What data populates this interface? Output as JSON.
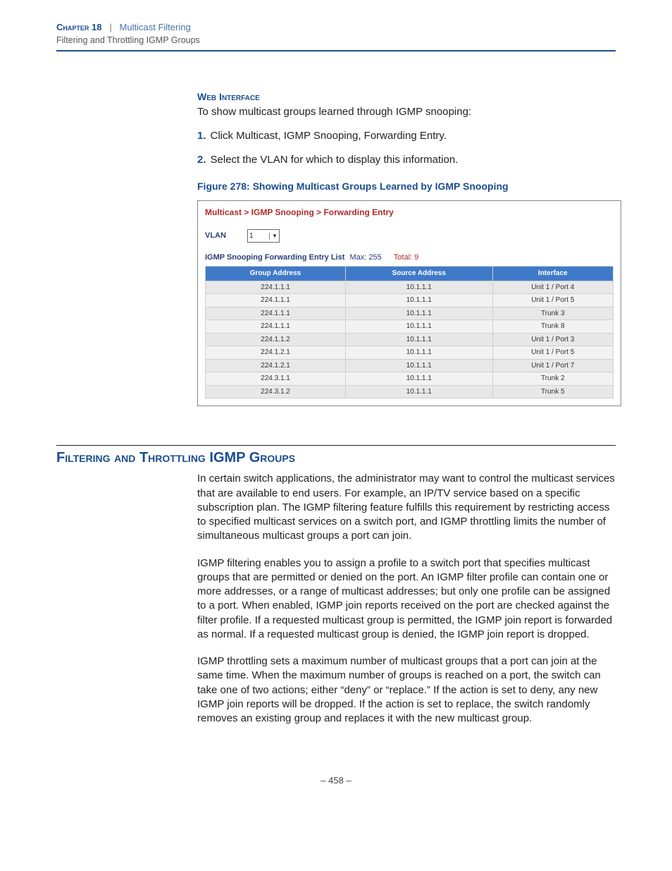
{
  "header": {
    "chapter_label": "Chapter 18",
    "separator": "|",
    "chapter_title": "Multicast Filtering",
    "subtitle": "Filtering and Throttling IGMP Groups"
  },
  "intro": {
    "heading": "Web Interface",
    "lead": "To show multicast groups learned through IGMP snooping:",
    "steps": [
      "Click Multicast, IGMP Snooping, Forwarding Entry.",
      "Select the VLAN for which to display this information."
    ],
    "figure_caption": "Figure 278:  Showing Multicast Groups Learned by IGMP Snooping"
  },
  "panel": {
    "breadcrumb": "Multicast > IGMP Snooping > Forwarding Entry",
    "vlan_label": "VLAN",
    "vlan_value": "1",
    "list_label": "IGMP Snooping Forwarding Entry List",
    "max_label": "Max: 255",
    "total_label": "Total: 9",
    "columns": [
      "Group Address",
      "Source Address",
      "Interface"
    ],
    "rows": [
      {
        "group": "224.1.1.1",
        "source": "10.1.1.1",
        "iface": "Unit 1 / Port 4"
      },
      {
        "group": "224.1.1.1",
        "source": "10.1.1.1",
        "iface": "Unit 1 / Port 5"
      },
      {
        "group": "224.1.1.1",
        "source": "10.1.1.1",
        "iface": "Trunk 3"
      },
      {
        "group": "224.1.1.1",
        "source": "10.1.1.1",
        "iface": "Trunk 8"
      },
      {
        "group": "224.1.1.2",
        "source": "10.1.1.1",
        "iface": "Unit 1 / Port 3"
      },
      {
        "group": "224.1.2.1",
        "source": "10.1.1.1",
        "iface": "Unit 1 / Port 5"
      },
      {
        "group": "224.1.2.1",
        "source": "10.1.1.1",
        "iface": "Unit 1 / Port 7"
      },
      {
        "group": "224.3.1.1",
        "source": "10.1.1.1",
        "iface": "Trunk 2"
      },
      {
        "group": "224.3.1.2",
        "source": "10.1.1.1",
        "iface": "Trunk 5"
      }
    ]
  },
  "section": {
    "title": "Filtering and Throttling IGMP Groups",
    "p1": "In certain switch applications, the administrator may want to control the multicast services that are available to end users. For example, an IP/TV service based on a specific subscription plan. The IGMP filtering feature fulfills this requirement by restricting access to specified multicast services on a switch port, and IGMP throttling limits the number of simultaneous multicast groups a port can join.",
    "p2": "IGMP filtering enables you to assign a profile to a switch port that specifies multicast groups that are permitted or denied on the port. An IGMP filter profile can contain one or more addresses, or a range of multicast addresses; but only one profile can be assigned to a port. When enabled, IGMP join reports received on the port are checked against the filter profile. If a requested multicast group is permitted, the IGMP join report is forwarded as normal. If a requested multicast group is denied, the IGMP join report is dropped.",
    "p3": "IGMP throttling sets a maximum number of multicast groups that a port can join at the same time. When the maximum number of groups is reached on a port, the switch can take one of two actions; either “deny” or “replace.” If the action is set to deny, any new IGMP join reports will be dropped. If the action is set to replace, the switch randomly removes an existing group and replaces it with the new multicast group."
  },
  "footer": {
    "page": "–  458  –"
  }
}
